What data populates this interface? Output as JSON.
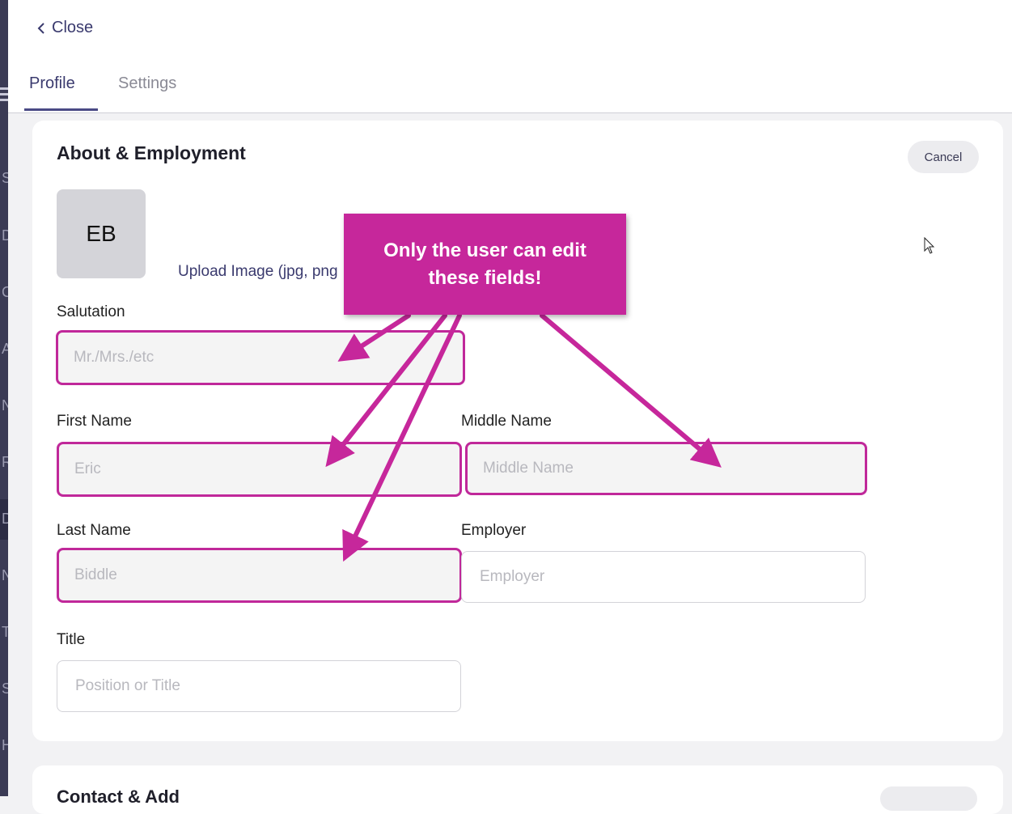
{
  "header": {
    "close_label": "Close",
    "tabs": [
      {
        "label": "Profile",
        "active": true
      },
      {
        "label": "Settings",
        "active": false
      }
    ]
  },
  "sidebar_letters": [
    "S",
    "D",
    "C",
    "A",
    "N",
    "R",
    "D",
    "N",
    "T",
    "S",
    "H"
  ],
  "section": {
    "title": "About & Employment",
    "cancel_label": "Cancel",
    "avatar_initials": "EB",
    "upload_label": "Upload Image (jpg, png"
  },
  "fields": {
    "salutation": {
      "label": "Salutation",
      "placeholder": "Mr./Mrs./etc"
    },
    "first_name": {
      "label": "First Name",
      "placeholder": "Eric"
    },
    "middle_name": {
      "label": "Middle Name",
      "placeholder": "Middle Name"
    },
    "last_name": {
      "label": "Last Name",
      "placeholder": "Biddle"
    },
    "employer": {
      "label": "Employer",
      "placeholder": "Employer"
    },
    "title": {
      "label": "Title",
      "placeholder": "Position or Title"
    }
  },
  "next_section": {
    "title": "Contact & Add"
  },
  "annotation": {
    "text": "Only the user can edit these fields!",
    "color": "#c6279b"
  },
  "colors": {
    "accent": "#3a3a6e",
    "highlight": "#c0289a"
  }
}
